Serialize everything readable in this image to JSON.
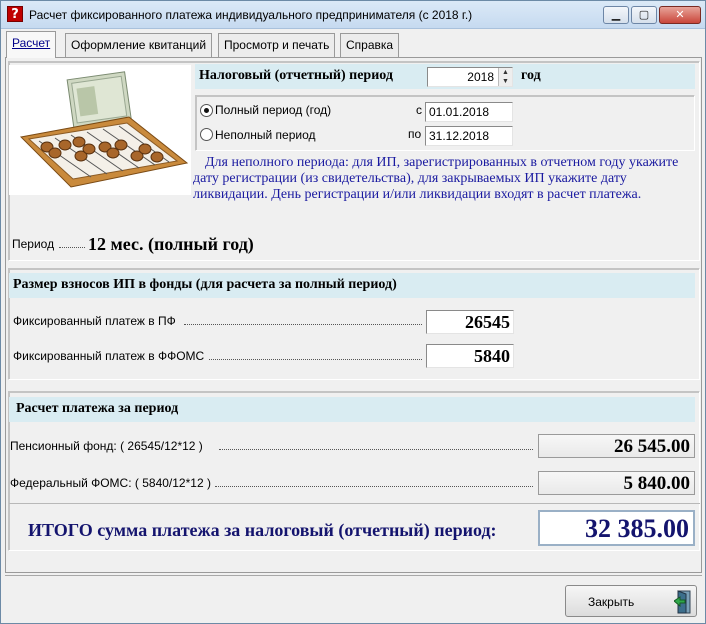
{
  "window": {
    "title": "Расчет фиксированного платежа индивидуального предпринимателя (с 2018 г.)",
    "icon_glyph": "?",
    "min_glyph": "▁",
    "max_glyph": "▢",
    "close_glyph": "✕"
  },
  "tabs": [
    {
      "label": "Расчет",
      "active": true
    },
    {
      "label": "Оформление квитанций",
      "active": false
    },
    {
      "label": "Просмотр и печать",
      "active": false
    },
    {
      "label": "Справка",
      "active": false
    }
  ],
  "period": {
    "header_label": "Налоговый (отчетный) период",
    "year_value": "2018",
    "year_suffix": "год",
    "radio_full_label": "Полный период (год)",
    "radio_partial_label": "Неполный период",
    "radio_selected": "full",
    "from_label": "с",
    "from_value": "01.01.2018",
    "to_label": "по",
    "to_value": "31.12.2018",
    "info_text": "Для неполного периода: для ИП, зарегистрированных в отчетном году укажите дату регистрации  (из свидетельства), для закрываемых ИП укажите дату ликвидации. День регистрации и/или ликвидации входят в расчет платежа.",
    "period_label": "Период",
    "period_value": "12 мес. (полный год)"
  },
  "contributions": {
    "header": "Размер взносов ИП в фонды (для расчета за полный период)",
    "pf_label": "Фиксированный платеж в ПФ",
    "pf_value": "26545",
    "ffoms_label": "Фиксированный платеж в ФФОМС",
    "ffoms_value": "5840"
  },
  "calculation": {
    "header": "Расчет платежа за период",
    "pension_label": "Пенсионный фонд: ( 26545/12*12 )",
    "pension_value": "26 545.00",
    "ffoms_label": "Федеральный ФОМС: ( 5840/12*12 )",
    "ffoms_value": "5 840.00",
    "total_label": "ИТОГО сумма платежа за налоговый (отчетный)  период:",
    "total_value": "32 385.00"
  },
  "footer": {
    "close_label": "Закрыть"
  },
  "colors": {
    "section_header_bg": "#d9ecf2",
    "info_text": "#1a1aa0",
    "total_text": "#14146e"
  }
}
